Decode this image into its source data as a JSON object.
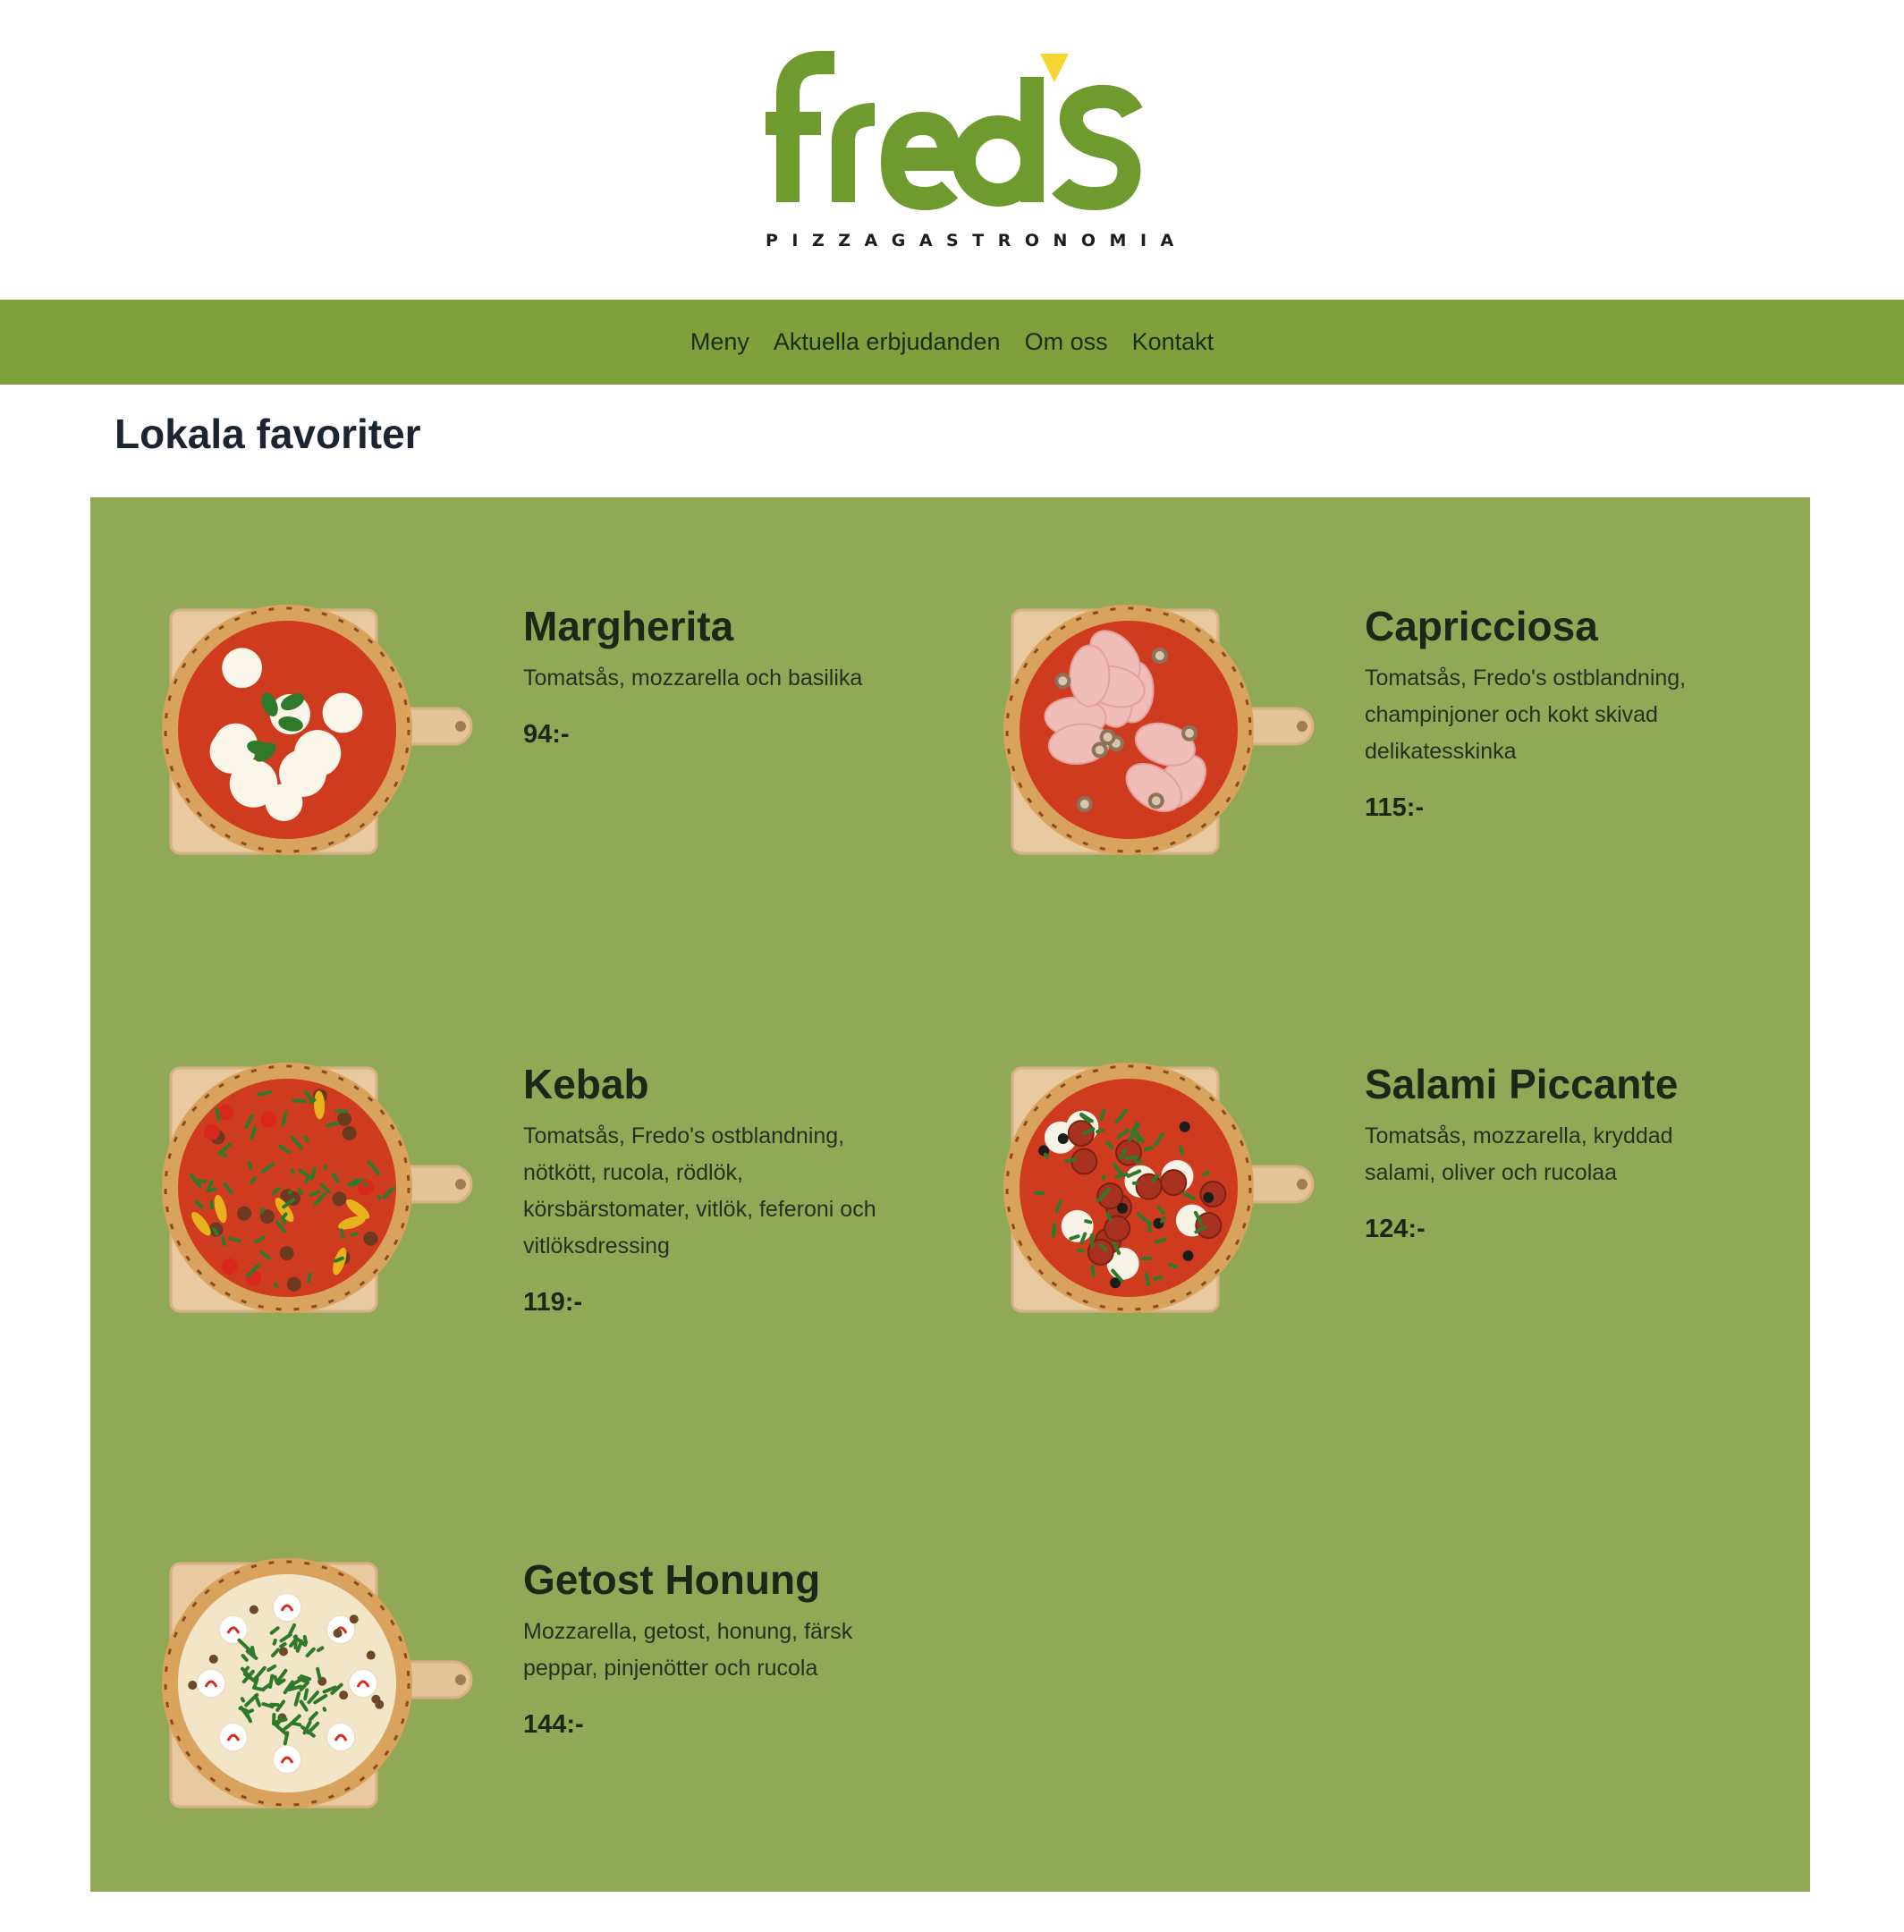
{
  "brand": {
    "name": "fredo's",
    "tagline": "PIZZAGASTRONOMIA",
    "logo_color": "#6f9a2e",
    "accent_color": "#f5d632"
  },
  "nav": {
    "background": "#7fa13b",
    "items": [
      {
        "label": "Meny"
      },
      {
        "label": "Aktuella erbjudanden"
      },
      {
        "label": "Om oss"
      },
      {
        "label": "Kontakt"
      }
    ]
  },
  "section": {
    "title": "Lokala favoriter",
    "panel_color": "#91a957"
  },
  "menu": [
    {
      "name": "Margherita",
      "description": "Tomatsås, mozzarella och basilika",
      "price": "94:-",
      "topping": "margherita"
    },
    {
      "name": "Capricciosa",
      "description": "Tomatsås, Fredo's ostblandning, champinjoner och kokt skivad delikatesskinka",
      "price": "115:-",
      "topping": "capricciosa"
    },
    {
      "name": "Kebab",
      "description": "Tomatsås, Fredo's ostblandning, nötkött, rucola, rödlök, körsbärstomater, vitlök, feferoni och vitlöksdressing",
      "price": "119:-",
      "topping": "kebab"
    },
    {
      "name": "Salami Piccante",
      "description": "Tomatsås, mozzarella, kryddad salami, oliver och rucolaa",
      "price": "124:-",
      "topping": "salami"
    },
    {
      "name": "Getost Honung",
      "description": "Mozzarella, getost, honung, färsk peppar, pinjenötter och rucola",
      "price": "144:-",
      "topping": "getost"
    }
  ]
}
